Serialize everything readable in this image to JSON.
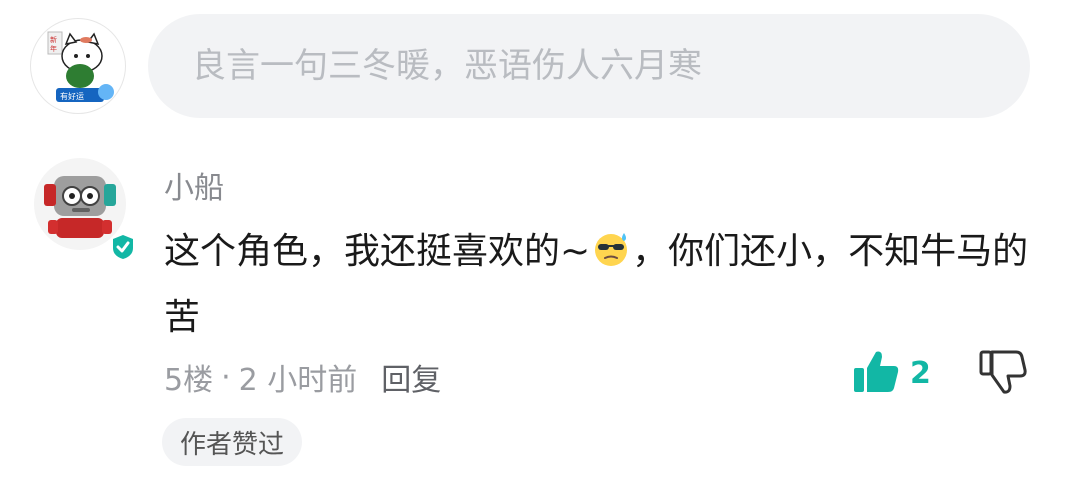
{
  "composer": {
    "avatar_icon": "cat-sticker-avatar-icon",
    "placeholder": "良言一句三冬暖，恶语伤人六月寒"
  },
  "comment": {
    "avatar_icon": "robot-avatar-icon",
    "verified_icon": "verified-badge-icon",
    "username": "小船",
    "text_part1": "这个角色，我还挺喜欢的~",
    "emoji_icon": "cool-sweat-emoji-icon",
    "text_part2": "，你们还小，不知牛马的苦",
    "floor": "5楼",
    "separator": "·",
    "time": "2 小时前",
    "reply_label": "回复",
    "like_icon": "thumbs-up-icon",
    "like_count": "2",
    "dislike_icon": "thumbs-down-icon",
    "author_liked_badge": "作者赞过"
  },
  "colors": {
    "accent": "#12b7a5",
    "input_bg": "#f2f3f5",
    "placeholder": "#b9bcc1",
    "meta_text": "#9a9ca1"
  }
}
